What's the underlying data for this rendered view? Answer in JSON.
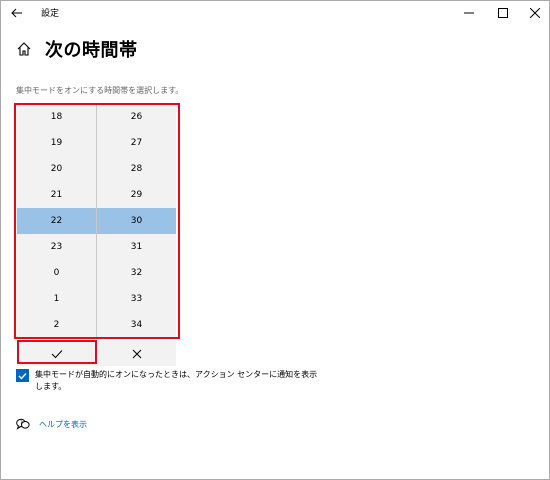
{
  "window": {
    "title": "設定"
  },
  "header": {
    "title": "次の時間帯"
  },
  "instruction": "集中モードをオンにする時間帯を選択します。",
  "picker": {
    "left_values": [
      "18",
      "19",
      "20",
      "21",
      "22",
      "23",
      "0",
      "1",
      "2"
    ],
    "right_values": [
      "26",
      "27",
      "28",
      "29",
      "30",
      "31",
      "32",
      "33",
      "34"
    ],
    "selected_left": "22",
    "selected_right": "30"
  },
  "actions": {
    "accept_icon": "checkmark-icon",
    "dismiss_icon": "close-icon"
  },
  "checkbox": {
    "checked": true,
    "label": "集中モードが自動的にオンになったときは、アクション センターに通知を表示します。"
  },
  "help": {
    "label": "ヘルプを表示"
  },
  "colors": {
    "accent": "#0067c0",
    "selection": "#99c2e6",
    "highlight": "#e00b1c"
  }
}
